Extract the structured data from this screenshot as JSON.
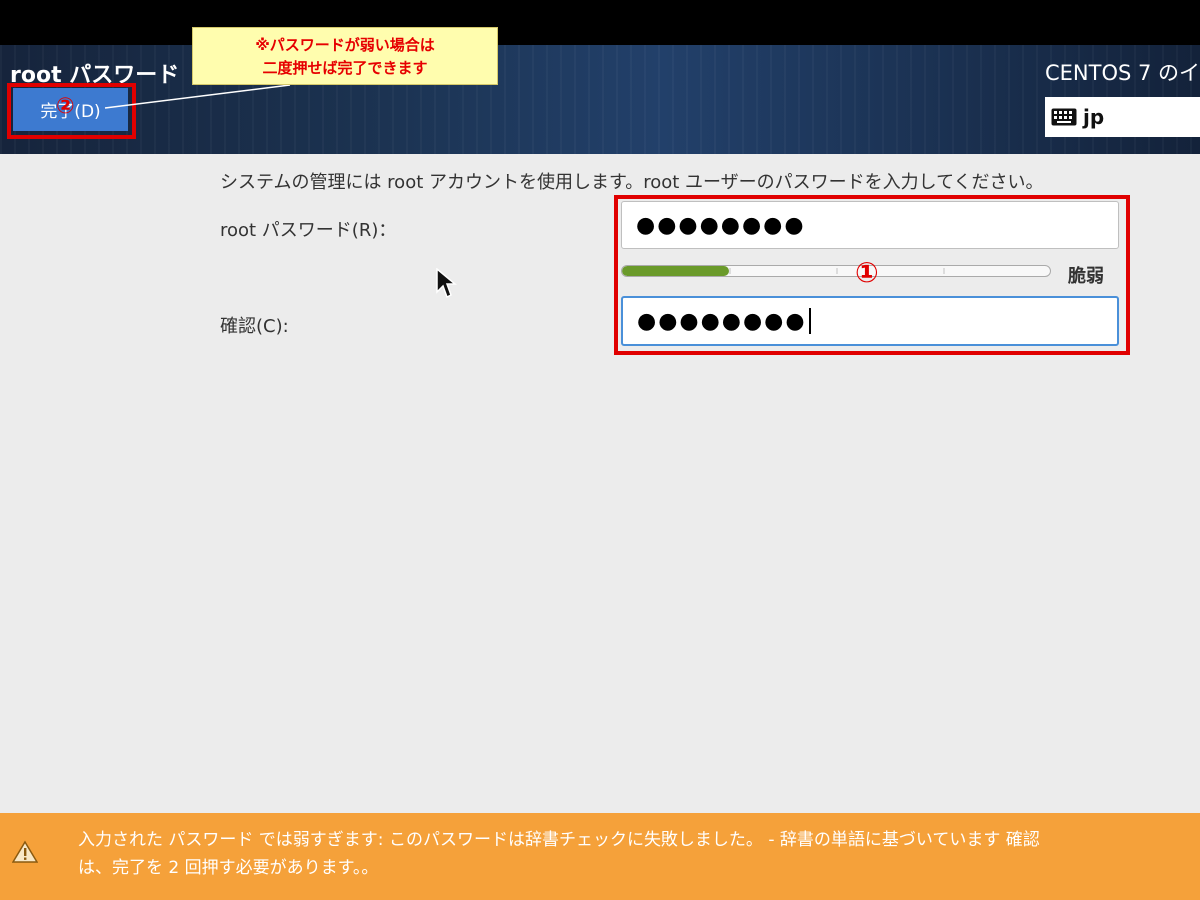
{
  "header": {
    "title": "root パスワード",
    "done_label": "完了(D)",
    "product": "CENTOS 7 のイ",
    "keyboard_layout": "jp"
  },
  "annotations": {
    "callout": "※パスワードが弱い場合は\n二度押せば完了できます",
    "marker_1": "①",
    "marker_2": "②",
    "highlight_color": "#e00000"
  },
  "form": {
    "description": "システムの管理には root アカウントを使用します。root ユーザーのパスワードを入力してください。",
    "password_label": "root パスワード(R)：",
    "password_value": "●●●●●●●●",
    "confirm_label": "確認(C):",
    "confirm_value": "●●●●●●●●",
    "strength_label": "脆弱",
    "strength_fraction": 0.25
  },
  "warning": {
    "text": "入力された パスワード では弱すぎます: このパスワードは辞書チェックに失敗しました。 - 辞書の単語に基づいています 確認\nは、完了を 2 回押す必要があります。。",
    "icon": "warning-icon"
  },
  "colors": {
    "header_bg": "#1b3250",
    "done_button": "#3d7ad0",
    "warning_bar": "#f5a13a",
    "strength_fill": "#6a9a2a"
  }
}
